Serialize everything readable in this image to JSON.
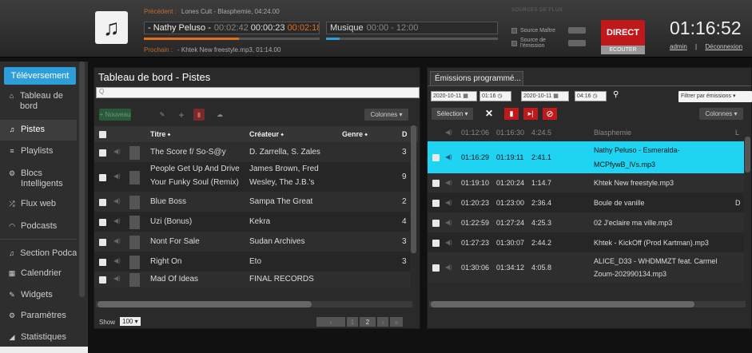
{
  "header": {
    "previous_label": "Précédent :",
    "previous_value": "Lones Cult - Blasphemie, 04:24.00",
    "current_artist": "- Nathy Peluso -",
    "current_elapsed": "00:02:42",
    "current_time": "00:00:23",
    "current_remaining": "00:02:18",
    "music_label": "Musique",
    "music_time": "00:00 - 12:00",
    "next_label": "Prochain :",
    "next_value": "- Khtek New freestyle.mp3, 01:14.00",
    "sources_title": "SOURCES DE FLUX",
    "source_master": "Source Maître",
    "source_show": "Source de l'émission",
    "direct_label": "DIRECT",
    "listen_label": "ECOUTER",
    "clock": "01:16:52",
    "user": "admin",
    "user_sep": "|",
    "logout": "Déconnexion",
    "progress_current": 0.54,
    "progress_music": 0.08
  },
  "sidebar": {
    "upload": "Téléversement",
    "items": [
      {
        "icon": "home-icon",
        "glyph": "⌂",
        "label": "Tableau de bord"
      },
      {
        "icon": "music-note-icon",
        "glyph": "♫",
        "label": "Pistes"
      },
      {
        "icon": "list-icon",
        "glyph": "≡",
        "label": "Playlists"
      },
      {
        "icon": "blocks-icon",
        "glyph": "⚙",
        "label": "Blocs Intelligents"
      },
      {
        "icon": "shuffle-icon",
        "glyph": "⤮",
        "label": "Flux web"
      },
      {
        "icon": "podcast-icon",
        "glyph": "◠",
        "label": "Podcasts"
      },
      {
        "icon": "music-note-icon",
        "glyph": "♫",
        "label": "Section Podca"
      },
      {
        "icon": "calendar-icon",
        "glyph": "▦",
        "label": "Calendrier"
      },
      {
        "icon": "wrench-icon",
        "glyph": "✎",
        "label": "Widgets"
      },
      {
        "icon": "gear-icon",
        "glyph": "⚙",
        "label": "Paramètres"
      },
      {
        "icon": "stats-icon",
        "glyph": "◢",
        "label": "Statistiques"
      }
    ]
  },
  "tracks": {
    "title": "Tableau de bord - Pistes",
    "search_placeholder": "Q",
    "new_label": "+ Nouveau",
    "columns_label": "Colonnes ▾",
    "headers": {
      "title": "Titre ⬩",
      "creator": "Créateur ⬩",
      "genre": "Genre ⬩",
      "d": "D"
    },
    "rows": [
      {
        "title": "The Score f/ So-S@y",
        "creator": "D. Zarrella, S. Zales",
        "extra": "3"
      },
      {
        "title": "People Get Up And Drive",
        "title2": "Your Funky Soul (Remix)",
        "creator": "James Brown, Fred",
        "creator2": "Wesley, The J.B.'s",
        "extra": "9"
      },
      {
        "title": "Blue Boss",
        "creator": "Sampa The Great",
        "extra": "2"
      },
      {
        "title": "Uzi (Bonus)",
        "creator": "Kekra",
        "extra": "4"
      },
      {
        "title": "Nont For Sale",
        "creator": "Sudan Archives",
        "extra": "3"
      },
      {
        "title": "Right On",
        "creator": "Eto",
        "extra": "3"
      },
      {
        "title": "Mad Of Ideas",
        "creator": "FINAL RECORDS",
        "extra": ""
      }
    ],
    "show_label": "Show",
    "show_value": "100 ▾",
    "pager_prev": "‹",
    "pager_page": "1",
    "pager_page2": "2",
    "pager_next": "›",
    "pager_last": "»"
  },
  "schedule": {
    "tab": "Émissions programmé...",
    "date_from": "2020-10-11",
    "time_from": "01:16",
    "date_to": "2020-10-11",
    "time_to": "04:16",
    "filter_label": "Filtrer par émissions ▾",
    "select_label": "Sélection ▾",
    "columns_label": "Colonnes ▾",
    "rows": [
      {
        "start": "01:12:06",
        "end": "01:16:30",
        "dur": "4:24.5",
        "title": "Blasphemie",
        "extra": "L",
        "state": "dim"
      },
      {
        "start": "01:16:29",
        "end": "01:19:11",
        "dur": "2:41.1",
        "title": "Nathy Peluso - Esmeralda-",
        "title2": "MCPfywB_lVs.mp3",
        "state": "hl"
      },
      {
        "start": "01:19:10",
        "end": "01:20:24",
        "dur": "1:14.7",
        "title": "Khtek New freestyle.mp3",
        "state": ""
      },
      {
        "start": "01:20:23",
        "end": "01:23:00",
        "dur": "2:36.4",
        "title": "Boule de vanille",
        "extra": "D",
        "state": ""
      },
      {
        "start": "01:22:59",
        "end": "01:27:24",
        "dur": "4:25.3",
        "title": "02 J'eclaire ma ville.mp3",
        "state": ""
      },
      {
        "start": "01:27:23",
        "end": "01:30:07",
        "dur": "2:44.2",
        "title": "Khtek - KickOff (Prod Kartman).mp3",
        "state": ""
      },
      {
        "start": "01:30:06",
        "end": "01:34:12",
        "dur": "4:05.8",
        "title": "ALICE_D33 - WHDMMZT feat. Carmel",
        "title2": "Zoum-202990134.mp3",
        "state": ""
      }
    ]
  },
  "colors": {
    "accent": "#2d9ed8",
    "direct": "#c0191c",
    "highlight": "#1fd3f2",
    "orange": "#e07020"
  }
}
